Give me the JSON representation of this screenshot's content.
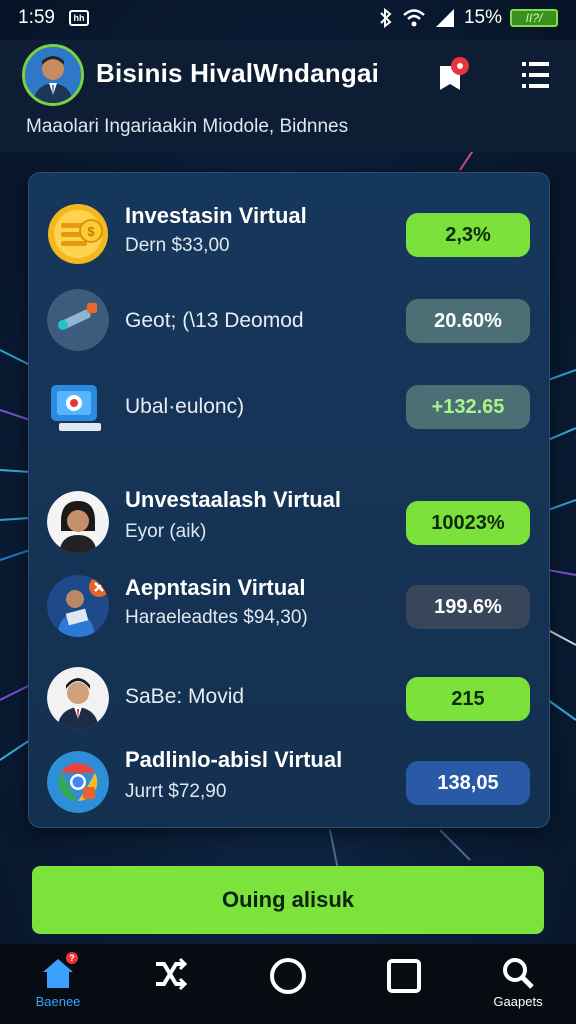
{
  "status_bar": {
    "time": "1:59",
    "notification_label": "hh",
    "battery_percent": "15%",
    "battery_label": "ӀӀ?/"
  },
  "header": {
    "app_title": "Bisinis HivalWndangai",
    "subtitle": "Maaolari Ingariaakin Miodole, Bidnnes",
    "avatar_icon": "user-avatar-icon",
    "notification_icon": "bell-icon",
    "menu_icon": "hamburger-menu-icon"
  },
  "investments": [
    {
      "icon": "gold-coins-icon",
      "name": "Investasin Virtual",
      "detail": "Dern $33,00",
      "value": "2,3%",
      "pill_style": "green"
    },
    {
      "icon": "tool-icon",
      "name": "",
      "detail": "Geot; (\\13 Deomod",
      "value": "20.60%",
      "pill_style": "grey"
    },
    {
      "icon": "monitor-icon",
      "name": "",
      "detail": "Ubal·eulonc)",
      "value": "+132.65",
      "pill_style": "greytext"
    },
    {
      "icon": "woman-avatar-icon",
      "name": "Unvestaalash Virtual",
      "detail": "Eyor (aik)",
      "value": "10023%",
      "pill_style": "green"
    },
    {
      "icon": "man-reading-avatar-icon",
      "name": "Aepntasin Virtual",
      "detail": "Haraeleadtes $94,30)",
      "value": "199.6%",
      "pill_style": "dark"
    },
    {
      "icon": "man-suit-avatar-icon",
      "name": "",
      "detail": "SaBe: Movid",
      "value": "215",
      "pill_style": "green"
    },
    {
      "icon": "chrome-logo-icon",
      "name": "Padlinlo-abisl Virtual",
      "detail": "Jurrt $72,90",
      "value": "138,05",
      "pill_style": "blue"
    }
  ],
  "cta": {
    "label": "Ouing alisuk"
  },
  "bottom_nav": [
    {
      "label": "Baenee",
      "icon": "home-icon",
      "active": true,
      "badge": "?"
    },
    {
      "label": "",
      "icon": "shuffle-icon",
      "active": false
    },
    {
      "label": "",
      "icon": "circle-home-icon",
      "active": false
    },
    {
      "label": "",
      "icon": "square-recents-icon",
      "active": false
    },
    {
      "label": "Gaapets",
      "icon": "search-icon",
      "active": false
    }
  ],
  "colors": {
    "accent_green": "#7de13c",
    "card_background": "#16375c",
    "screen_background": "#0b1f3a",
    "active_nav": "#3aa1ff"
  }
}
